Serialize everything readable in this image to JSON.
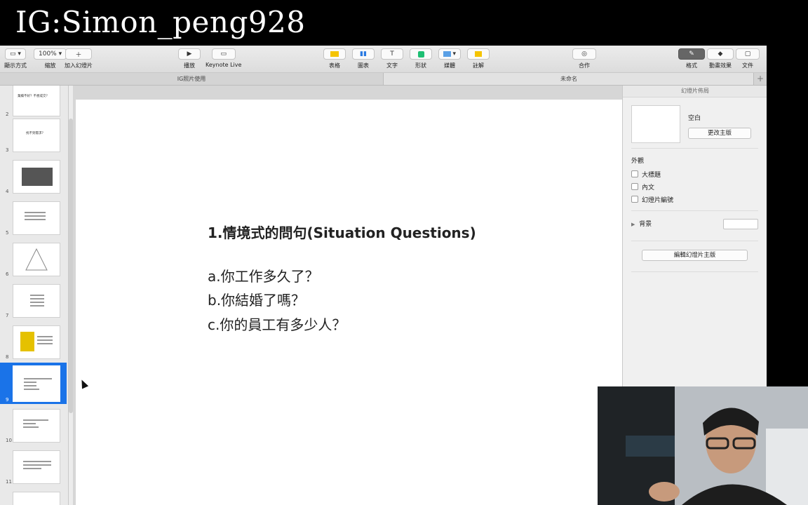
{
  "overlay": {
    "title": "IG:Simon_peng928"
  },
  "toolbar": {
    "view_label": "顯示方式",
    "zoom_value": "100%",
    "zoom_label": "縮放",
    "add_slide_label": "加入幻燈片",
    "play_label": "播放",
    "keynote_live_label": "Keynote Live",
    "table_label": "表格",
    "chart_label": "圖表",
    "text_label": "文字",
    "shape_label": "形狀",
    "media_label": "媒體",
    "comment_label": "註解",
    "collaborate_label": "合作",
    "format_label": "格式",
    "animate_label": "動畫效果",
    "document_label": "文件"
  },
  "tabs": [
    {
      "label": "IG照片使用"
    },
    {
      "label": "未命名"
    }
  ],
  "navigator": {
    "slides": [
      {
        "number": "2",
        "text": "業績不好？不想成交？"
      },
      {
        "number": "3",
        "text": "找不到需求？"
      },
      {
        "number": "4",
        "text": ""
      },
      {
        "number": "5",
        "text": ""
      },
      {
        "number": "6",
        "text": ""
      },
      {
        "number": "7",
        "text": ""
      },
      {
        "number": "8",
        "text": ""
      },
      {
        "number": "9",
        "text": ""
      },
      {
        "number": "10",
        "text": ""
      },
      {
        "number": "11",
        "text": ""
      }
    ],
    "selected_number": "9"
  },
  "slide": {
    "heading": "1.情境式的問句(Situation Questions)",
    "items": [
      "a.你工作多久了？",
      "b.你結婚了嗎？",
      "c.你的員工有多少人？"
    ]
  },
  "inspector": {
    "header": "幻燈片佈局",
    "layout_name": "空白",
    "change_master_button": "更改主版",
    "appearance_label": "外觀",
    "checkbox_title": "大標題",
    "checkbox_body": "內文",
    "checkbox_slide_number": "幻燈片編號",
    "background_label": "背景",
    "edit_master_button": "編輯幻燈片主版"
  }
}
